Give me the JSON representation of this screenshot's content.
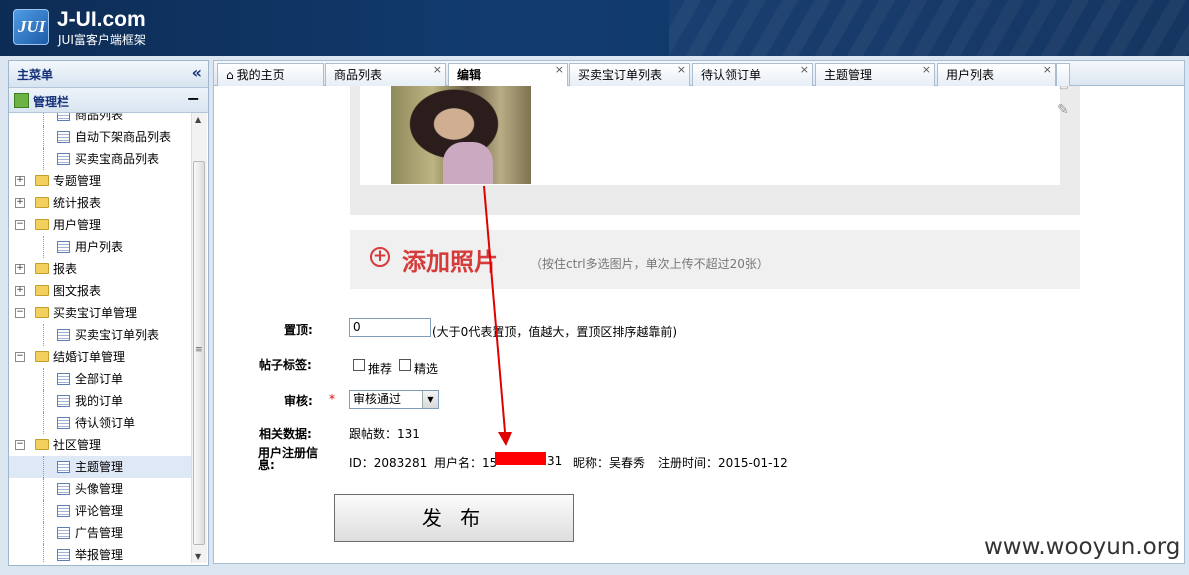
{
  "header": {
    "logo_mark": "JUI",
    "title": "J-UI.com",
    "subtitle": "JUI富客户端框架"
  },
  "sidebar": {
    "title": "主菜单",
    "collapse_icon": "«",
    "panel_title": "管理栏",
    "panel_toggle": "−",
    "items": [
      {
        "label": "商品列表",
        "type": "leaf",
        "level": 2
      },
      {
        "label": "自动下架商品列表",
        "type": "leaf",
        "level": 2
      },
      {
        "label": "买卖宝商品列表",
        "type": "leaf",
        "level": 2
      },
      {
        "label": "专题管理",
        "type": "folder",
        "level": 1,
        "expanded": false
      },
      {
        "label": "统计报表",
        "type": "folder",
        "level": 1,
        "expanded": false
      },
      {
        "label": "用户管理",
        "type": "folder",
        "level": 1,
        "expanded": true
      },
      {
        "label": "用户列表",
        "type": "leaf",
        "level": 2
      },
      {
        "label": "报表",
        "type": "folder",
        "level": 1,
        "expanded": false
      },
      {
        "label": "图文报表",
        "type": "folder",
        "level": 1,
        "expanded": false
      },
      {
        "label": "买卖宝订单管理",
        "type": "folder",
        "level": 1,
        "expanded": true
      },
      {
        "label": "买卖宝订单列表",
        "type": "leaf",
        "level": 2
      },
      {
        "label": "结婚订单管理",
        "type": "folder",
        "level": 1,
        "expanded": true
      },
      {
        "label": "全部订单",
        "type": "leaf",
        "level": 2
      },
      {
        "label": "我的订单",
        "type": "leaf",
        "level": 2
      },
      {
        "label": "待认领订单",
        "type": "leaf",
        "level": 2
      },
      {
        "label": "社区管理",
        "type": "folder",
        "level": 1,
        "expanded": true
      },
      {
        "label": "主题管理",
        "type": "leaf",
        "level": 2,
        "selected": true
      },
      {
        "label": "头像管理",
        "type": "leaf",
        "level": 2
      },
      {
        "label": "评论管理",
        "type": "leaf",
        "level": 2
      },
      {
        "label": "广告管理",
        "type": "leaf",
        "level": 2
      },
      {
        "label": "举报管理",
        "type": "leaf",
        "level": 2
      }
    ]
  },
  "tabs": [
    {
      "label": "我的主页",
      "home": true,
      "closable": false
    },
    {
      "label": "商品列表",
      "closable": true
    },
    {
      "label": "编辑",
      "closable": true,
      "active": true
    },
    {
      "label": "买卖宝订单列表",
      "closable": true
    },
    {
      "label": "待认领订单",
      "closable": true
    },
    {
      "label": "主题管理",
      "closable": true
    },
    {
      "label": "用户列表",
      "closable": true
    }
  ],
  "photo_section": {
    "add_label": "添加照片",
    "add_hint": "（按住ctrl多选图片，单次上传不超过20张）"
  },
  "form": {
    "top": {
      "label": "置顶:",
      "value": "0",
      "hint": "(大于0代表置顶，值越大，置顶区排序越靠前)"
    },
    "tags": {
      "label": "帖子标签:",
      "options": [
        "推荐",
        "精选"
      ]
    },
    "review": {
      "label": "审核:",
      "required_mark": "*",
      "selected": "审核通过"
    },
    "related": {
      "label": "相关数据:",
      "text": "跟帖数：131"
    },
    "user_info": {
      "label": "用户注册信息:",
      "id": "ID：2083281",
      "username_prefix": "用户名：15",
      "username_suffix": "31",
      "nickname": "昵称：吴春秀",
      "reg_time": "注册时间：2015-01-12"
    },
    "submit": "发 布"
  },
  "watermark": "www.wooyun.org",
  "colors": {
    "accent_red": "#d53b3b",
    "redaction": "#ff0000",
    "header_bg": "#123c70"
  }
}
